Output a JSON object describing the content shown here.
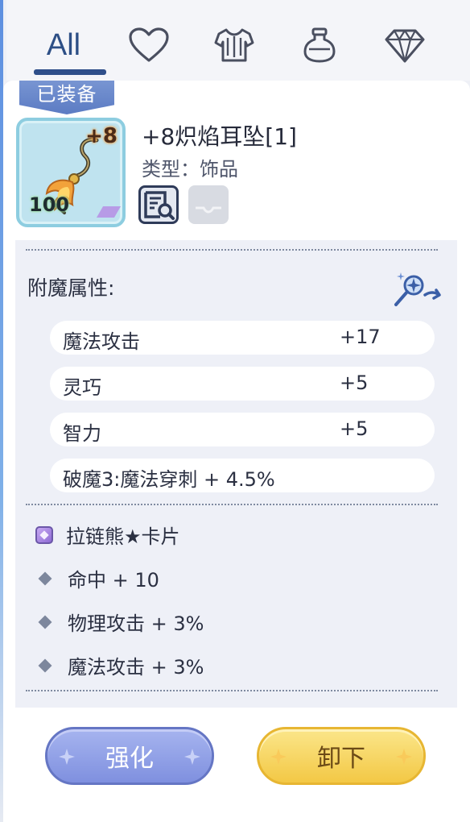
{
  "tabs": {
    "all_label": "All",
    "icons": [
      "heart-icon",
      "armor-icon",
      "potion-icon",
      "gem-icon"
    ],
    "active": "All"
  },
  "item": {
    "badge": "已装备",
    "refine": "+8",
    "count": "100",
    "name": "+8炽焰耳坠[1]",
    "type": "类型：饰品"
  },
  "enchant": {
    "title": "附魔属性:",
    "rows": [
      {
        "name": "魔法攻击",
        "value": "+17"
      },
      {
        "name": "灵巧",
        "value": "+5"
      },
      {
        "name": "智力",
        "value": "+5"
      },
      {
        "name": "破魔3:魔法穿刺 + 4.5%",
        "value": ""
      }
    ]
  },
  "card": {
    "name": "拉链熊★卡片",
    "effects": [
      "命中 + 10",
      "物理攻击 + 3%",
      "魔法攻击 + 3%"
    ]
  },
  "buttons": {
    "enhance": "强化",
    "unequip": "卸下"
  },
  "colors": {
    "accent": "#2f4f8a",
    "enhance": "#8a9be3",
    "unequip": "#f6d458"
  }
}
